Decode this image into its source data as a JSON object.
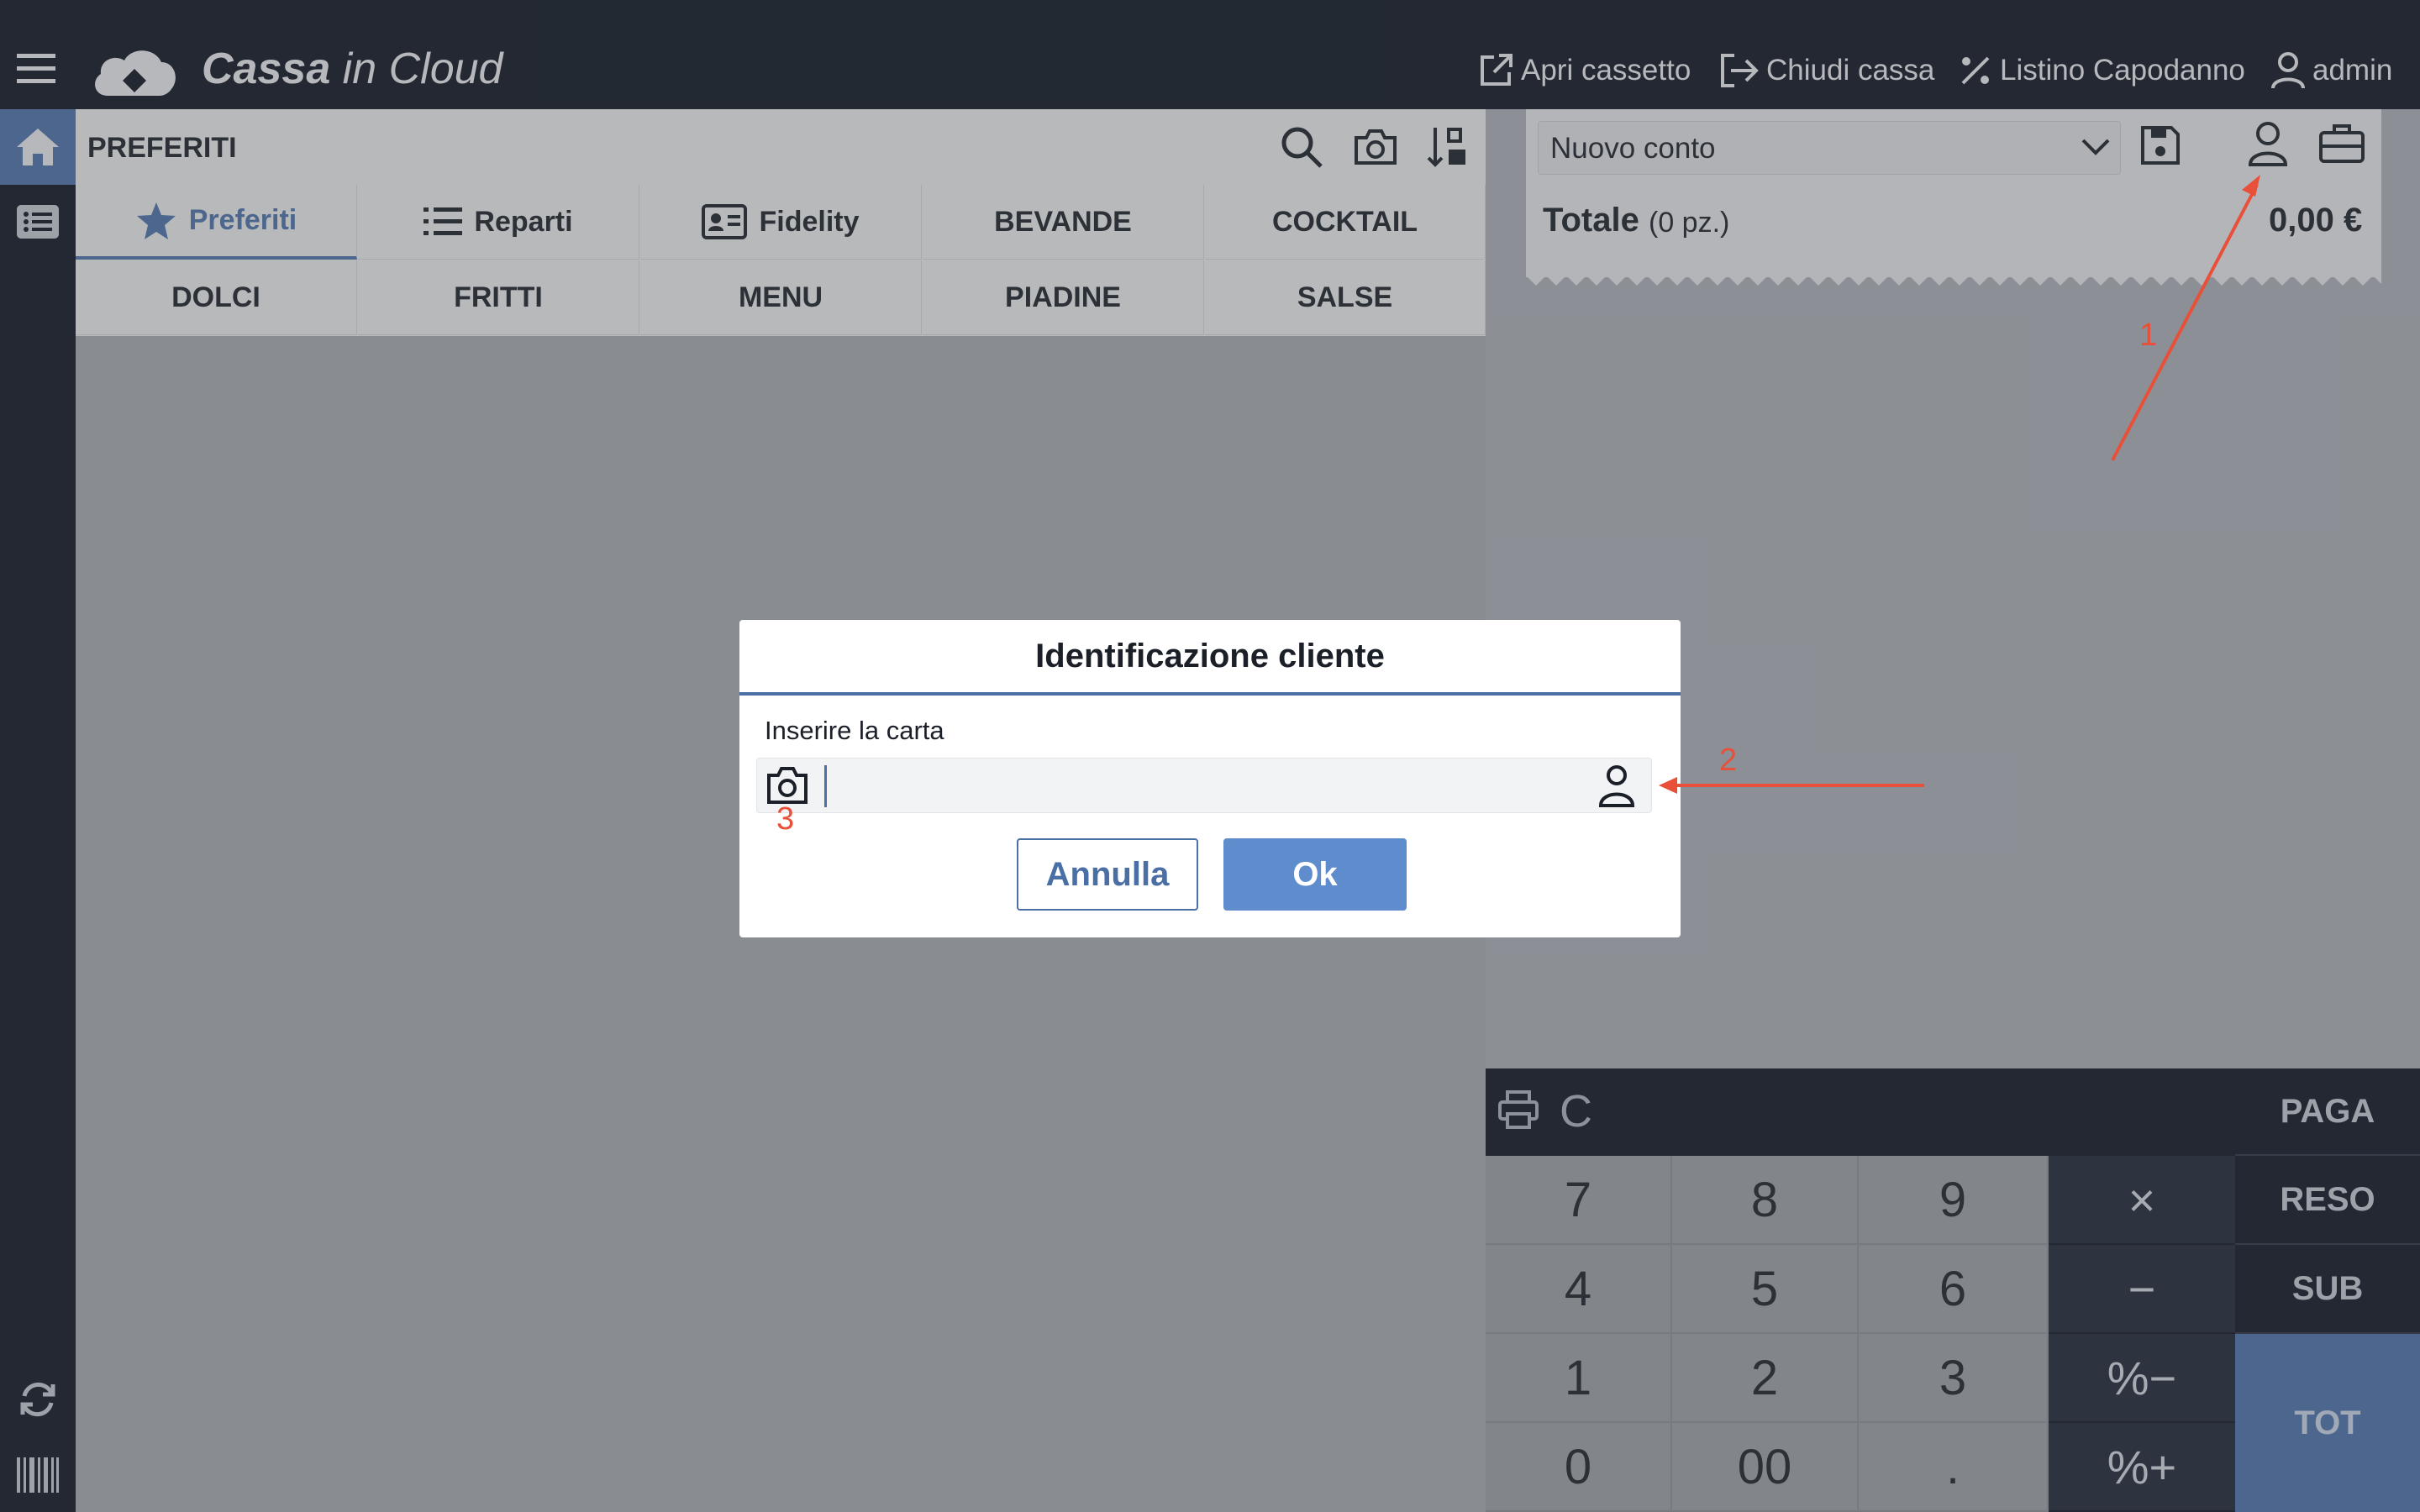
{
  "app": {
    "brand_main": "Cassa",
    "brand_rest": " in Cloud"
  },
  "topbar": {
    "actions": [
      {
        "label": "Apri cassetto",
        "icon": "external-link-icon"
      },
      {
        "label": "Chiudi cassa",
        "icon": "logout-icon"
      },
      {
        "label": "Listino Capodanno",
        "icon": "percent-icon"
      },
      {
        "label": "admin",
        "icon": "user-icon"
      }
    ]
  },
  "left_panel": {
    "title": "PREFERITI",
    "tabs_row1": [
      {
        "label": "Preferiti",
        "icon": "star-icon",
        "active": true
      },
      {
        "label": "Reparti",
        "icon": "list-icon"
      },
      {
        "label": "Fidelity",
        "icon": "id-card-icon"
      },
      {
        "label": "BEVANDE"
      },
      {
        "label": "COCKTAIL"
      }
    ],
    "tabs_row2": [
      {
        "label": "DOLCI"
      },
      {
        "label": "FRITTI"
      },
      {
        "label": "MENU"
      },
      {
        "label": "PIADINE"
      },
      {
        "label": "SALSE"
      }
    ]
  },
  "receipt": {
    "account_select": "Nuovo conto",
    "total_label": "Totale",
    "total_pieces": "(0 pz.)",
    "total_value": "0,00 €"
  },
  "keypad": {
    "clear": "C",
    "pay": "PAGA",
    "refund": "RESO",
    "subtotal": "SUB",
    "total": "TOT",
    "rows": [
      [
        "7",
        "8",
        "9"
      ],
      [
        "4",
        "5",
        "6"
      ],
      [
        "1",
        "2",
        "3"
      ],
      [
        "0",
        "00",
        "."
      ]
    ],
    "ops": [
      "×",
      "−",
      "%−",
      "%+"
    ]
  },
  "modal": {
    "title": "Identificazione cliente",
    "field_label": "Inserire la carta",
    "field_value": "",
    "cancel": "Annulla",
    "ok": "Ok"
  },
  "annotations": {
    "one": "1",
    "two": "2",
    "three": "3",
    "color": "#e8503a"
  },
  "colors": {
    "accent": "#4a6fa5",
    "topbar": "#0e1421"
  }
}
